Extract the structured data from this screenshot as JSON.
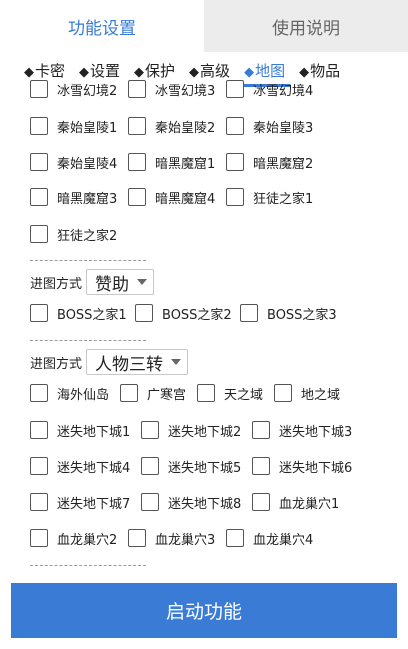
{
  "top_tabs": [
    "功能设置",
    "使用说明"
  ],
  "sub_tabs": [
    "卡密",
    "设置",
    "保护",
    "高级",
    "地图",
    "物品"
  ],
  "sub_tab_marker": "◆",
  "groups": {
    "cut_row": [
      "冰雪幻境2",
      "冰雪幻境3",
      "冰雪幻境4"
    ],
    "row1": [
      "秦始皇陵1",
      "秦始皇陵2",
      "秦始皇陵3"
    ],
    "row2": [
      "秦始皇陵4",
      "暗黑魔窟1",
      "暗黑魔窟2"
    ],
    "row3": [
      "暗黑魔窟3",
      "暗黑魔窟4",
      "狂徒之家1"
    ],
    "row4": [
      "狂徒之家2"
    ],
    "boss_row": [
      "BOSS之家1",
      "BOSS之家2",
      "BOSS之家3"
    ],
    "row5": [
      "海外仙岛",
      "广寒宫",
      "天之域",
      "地之域"
    ],
    "row6": [
      "迷失地下城1",
      "迷失地下城2",
      "迷失地下城3"
    ],
    "row7": [
      "迷失地下城4",
      "迷失地下城5",
      "迷失地下城6"
    ],
    "row8": [
      "迷失地下城7",
      "迷失地下城8",
      "血龙巢穴1"
    ],
    "row9": [
      "血龙巢穴2",
      "血龙巢穴3",
      "血龙巢穴4"
    ]
  },
  "mode1": {
    "label": "进图方式",
    "value": "赞助"
  },
  "mode2": {
    "label": "进图方式",
    "value": "人物三转"
  },
  "start_button": "启动功能",
  "accent_color": "#3a7bd5"
}
